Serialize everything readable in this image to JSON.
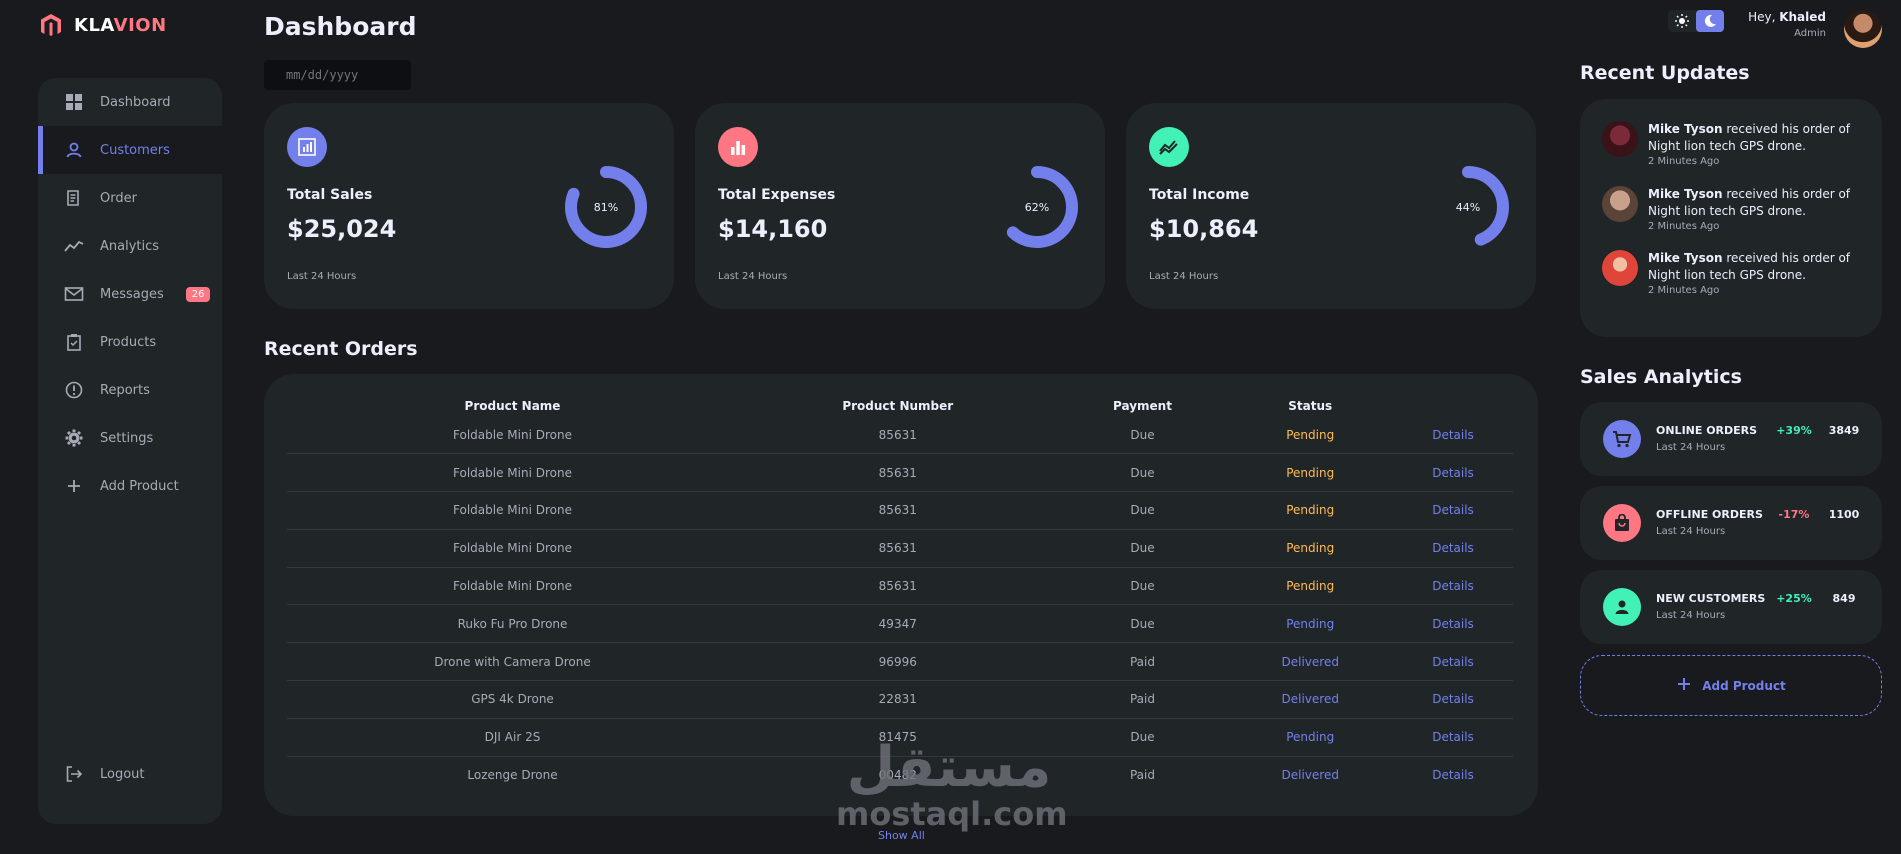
{
  "brand": {
    "name_part1": "KLA",
    "name_part2": "VION"
  },
  "sidebar": {
    "items": [
      {
        "label": "Dashboard"
      },
      {
        "label": "Customers"
      },
      {
        "label": "Order"
      },
      {
        "label": "Analytics"
      },
      {
        "label": "Messages",
        "badge": "26"
      },
      {
        "label": "Products"
      },
      {
        "label": "Reports"
      },
      {
        "label": "Settings"
      },
      {
        "label": "Add Product"
      }
    ],
    "logout": "Logout",
    "active": "Customers"
  },
  "header": {
    "title": "Dashboard",
    "date_placeholder": "mm/dd/yyyy",
    "greeting": "Hey, ",
    "user_name": "Khaled",
    "role": "Admin"
  },
  "cards": [
    {
      "label": "Total Sales",
      "value": "$25,024",
      "percent_text": "81%",
      "percent": 81,
      "foot": "Last 24 Hours",
      "color": "#7380ec"
    },
    {
      "label": "Total Expenses",
      "value": "$14,160",
      "percent_text": "62%",
      "percent": 62,
      "foot": "Last 24 Hours",
      "color": "#ff7782"
    },
    {
      "label": "Total Income",
      "value": "$10,864",
      "percent_text": "44%",
      "percent": 44,
      "foot": "Last 24 Hours",
      "color": "#41f1b6"
    }
  ],
  "recent_orders": {
    "title": "Recent Orders",
    "columns": [
      "Product Name",
      "Product Number",
      "Payment",
      "Status",
      ""
    ],
    "rows": [
      [
        "Foldable Mini Drone",
        "85631",
        "Due",
        "Pending",
        "Details"
      ],
      [
        "Foldable Mini Drone",
        "85631",
        "Due",
        "Pending",
        "Details"
      ],
      [
        "Foldable Mini Drone",
        "85631",
        "Due",
        "Pending",
        "Details"
      ],
      [
        "Foldable Mini Drone",
        "85631",
        "Due",
        "Pending",
        "Details"
      ],
      [
        "Foldable Mini Drone",
        "85631",
        "Due",
        "Pending",
        "Details"
      ],
      [
        "Ruko Fu Pro Drone",
        "49347",
        "Due",
        "Pending",
        "Details"
      ],
      [
        "Drone with Camera Drone",
        "96996",
        "Paid",
        "Delivered",
        "Details"
      ],
      [
        "GPS 4k Drone",
        "22831",
        "Paid",
        "Delivered",
        "Details"
      ],
      [
        "DJI Air 2S",
        "81475",
        "Due",
        "Pending",
        "Details"
      ],
      [
        "Lozenge Drone",
        "00482",
        "Paid",
        "Delivered",
        "Details"
      ]
    ],
    "show_all": "Show All"
  },
  "recent_updates": {
    "title": "Recent Updates",
    "items": [
      {
        "name": "Mike Tyson",
        "text": " received his order of Night lion tech GPS drone.",
        "time": "2 Minutes Ago"
      },
      {
        "name": "Mike Tyson",
        "text": " received his order of Night lion tech GPS drone.",
        "time": "2 Minutes Ago"
      },
      {
        "name": "Mike Tyson",
        "text": " received his order of Night lion tech GPS drone.",
        "time": "2 Minutes Ago"
      }
    ]
  },
  "sales_analytics": {
    "title": "Sales Analytics",
    "items": [
      {
        "name": "ONLINE ORDERS",
        "sub": "Last 24 Hours",
        "pct": "+39%",
        "value": "3849",
        "color": "#7380ec",
        "pct_color": "#41f1b6"
      },
      {
        "name": "OFFLINE ORDERS",
        "sub": "Last 24 Hours",
        "pct": "-17%",
        "value": "1100",
        "color": "#ff7782",
        "pct_color": "#ff7782"
      },
      {
        "name": "NEW CUSTOMERS",
        "sub": "Last 24 Hours",
        "pct": "+25%",
        "value": "849",
        "color": "#41f1b6",
        "pct_color": "#41f1b6"
      }
    ],
    "add_product": "Add Product"
  },
  "watermark": {
    "arabic": "مستقل",
    "latin": "mostaql.com"
  },
  "icons": {
    "sun": "sun-icon",
    "moon": "moon-icon",
    "grid": "grid-icon",
    "person": "person-icon",
    "receipt": "receipt-icon",
    "trend": "trend-icon",
    "mail": "mail-icon",
    "clipboard": "clipboard-icon",
    "report": "report-icon",
    "gear": "gear-icon",
    "plus": "plus-icon",
    "logout": "logout-icon",
    "cart": "cart-icon",
    "bag": "bag-icon"
  }
}
